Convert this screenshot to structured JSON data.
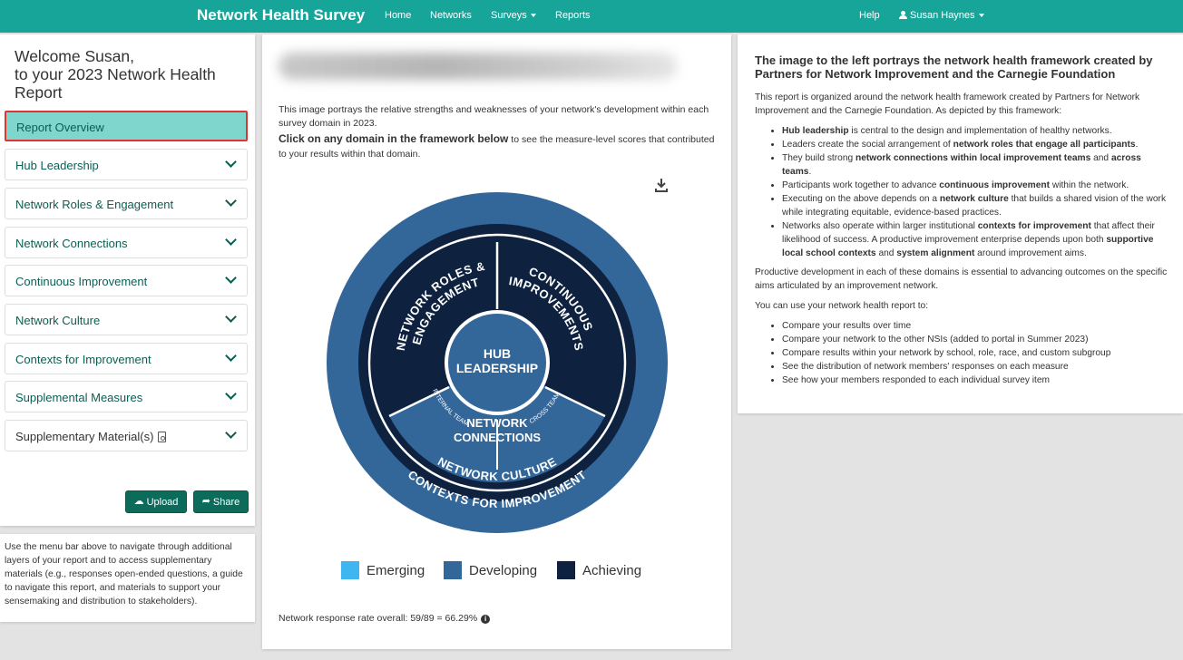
{
  "navbar": {
    "brand": "Network Health Survey",
    "links": [
      "Home",
      "Networks",
      "Surveys",
      "Reports"
    ],
    "help": "Help",
    "user": "Susan Haynes"
  },
  "sidebar": {
    "welcome_line1": "Welcome Susan,",
    "welcome_line2": "to your 2023 Network Health Report",
    "items": [
      "Report Overview",
      "Hub Leadership",
      "Network Roles & Engagement",
      "Network Connections",
      "Continuous Improvement",
      "Network Culture",
      "Contexts for Improvement",
      "Supplemental Measures",
      "Supplementary Material(s)"
    ],
    "upload_label": "Upload",
    "share_label": "Share",
    "note": "Use the menu bar above to navigate through additional layers of your report and to access supplementary materials (e.g., responses open-ended questions, a guide to navigate this report, and materials to support your sensemaking and distribution to stakeholders)."
  },
  "center": {
    "intro": "This image portrays the relative strengths and weaknesses of your network's development within each survey domain in 2023.",
    "click_bold": "Click on any domain in the framework below",
    "click_rest": " to see the measure-level scores that contributed to your results within that domain.",
    "framework": {
      "hub": [
        "HUB",
        "LEADERSHIP"
      ],
      "roles": [
        "NETWORK ROLES &",
        "ENGAGEMENT"
      ],
      "continuous": [
        "CONTINUOUS",
        "IMPROVEMENTS"
      ],
      "connections": [
        "NETWORK",
        "CONNECTIONS"
      ],
      "internal": "INTERNAL TEAM",
      "cross": "CROSS TEAM",
      "culture": "NETWORK CULTURE",
      "contexts": "CONTEXTS FOR IMPROVEMENT",
      "colors": {
        "achieving": "#0e2240",
        "developing": "#336699",
        "emerging": "#3fb6f0"
      }
    },
    "legend": [
      {
        "label": "Emerging",
        "color": "#3fb6f0"
      },
      {
        "label": "Developing",
        "color": "#336699"
      },
      {
        "label": "Achieving",
        "color": "#0e2240"
      }
    ],
    "response": "Network response rate overall: 59/89 = 66.29%"
  },
  "right": {
    "heading": "The image to the left portrays the network health framework created by Partners for Network Improvement and the Carnegie Foundation",
    "p1": "This report is organized around the network health framework created by Partners for Network Improvement and the Carnegie Foundation. As depicted by this framework:",
    "bullets": [
      {
        "b1": "Hub leadership",
        "t1": " is central to the design and implementation of healthy networks."
      },
      {
        "t0": "Leaders create the social arrangement of ",
        "b1": "network roles that engage all participants",
        "t1": "."
      },
      {
        "t0": "They build strong ",
        "b1": "network connections within local improvement teams",
        "t1": " and ",
        "b2": "across teams",
        "t2": "."
      },
      {
        "t0": "Participants work together to advance ",
        "b1": "continuous improvement",
        "t1": " within the network."
      },
      {
        "t0": "Executing on the above depends on a ",
        "b1": "network culture",
        "t1": " that builds a shared vision of the work while integrating equitable, evidence-based practices."
      },
      {
        "t0": "Networks also operate within larger institutional ",
        "b1": "contexts for improvement",
        "t1": " that affect their likelihood of success. A productive improvement enterprise depends upon both ",
        "b2": "supportive local school contexts",
        "t2": " and ",
        "b3": "system alignment",
        "t3": " around improvement aims."
      }
    ],
    "p2": "Productive development in each of these domains is essential to advancing outcomes on the specific aims articulated by an improvement network.",
    "p3": "You can use your network health report to:",
    "uses": [
      "Compare your results over time",
      "Compare your network to the other NSIs (added to portal in Summer 2023)",
      "Compare results within your network by school, role, race, and custom subgroup",
      "See the distribution of network members' responses on each measure",
      "See how your members responded to each individual survey item"
    ]
  }
}
